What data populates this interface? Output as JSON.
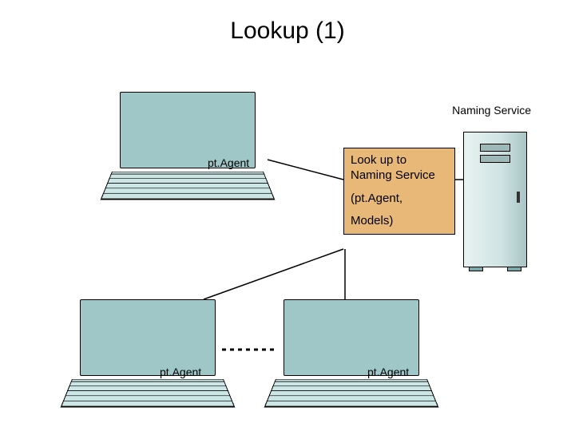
{
  "title": "Lookup (1)",
  "naming_service_label": "Naming Service",
  "lookup_box": {
    "line1": "Look up to Naming Service",
    "line2": "(pt.Agent,",
    "line3": "Models)"
  },
  "laptops": {
    "top": {
      "label": "pt.Agent"
    },
    "bottom_left": {
      "label": "pt.Agent"
    },
    "bottom_right": {
      "label": "pt.Agent"
    }
  }
}
